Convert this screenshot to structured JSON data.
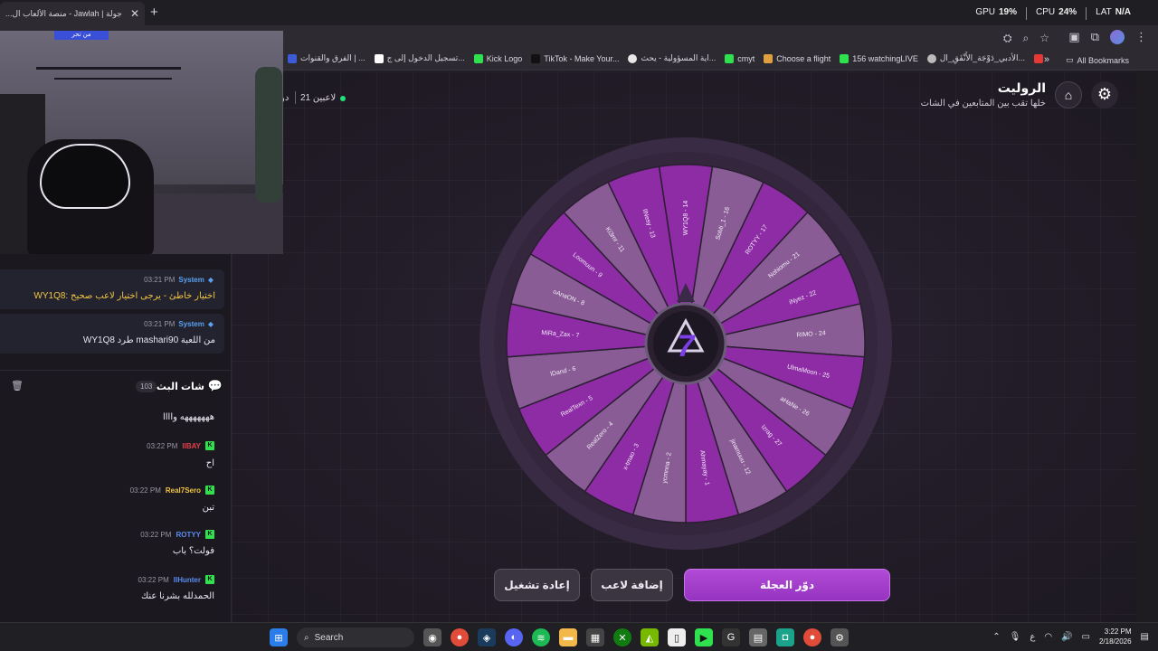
{
  "browser": {
    "tab_title": "جولة | Jawlah - منصة الألعاب ال...",
    "tab_close": "✕",
    "new_tab": "+",
    "hud": {
      "gpu_label": "GPU",
      "gpu_value": "19%",
      "cpu_label": "CPU",
      "cpu_value": "24%",
      "lat_label": "LAT",
      "lat_value": "N/A"
    },
    "bookmarks": [
      "الأدبي_دَوْجَة_الأَنْفَقِ_ال...",
      "156 watchingLIVE",
      "Choose a flight",
      "cmyt",
      "اية المسؤولية - يحث...",
      "TikTok - Make Your...",
      "Kick Logo",
      "تسجيل الدخول إلى ج...",
      "الفرق والقنوات | ..."
    ],
    "bookmarks_more": "»",
    "all_bookmarks": "All Bookmarks"
  },
  "stream_overlay": {
    "camera_tag": "ﻣﻦ ﺗﺤﺮ"
  },
  "app": {
    "title": "الروليت",
    "subtitle": "خلها تقب بين المتابعين في الشات",
    "players": "21 لاعبين",
    "players_fragment": "دو",
    "buttons": {
      "restart": "إعادة تشغيل",
      "add_player": "إضافة لاعب",
      "spin": "دوّر العجلة"
    }
  },
  "wheel": {
    "center_logo": "7",
    "segments": [
      "WY1Q8 - 14",
      "SoMi_1 - 16",
      "ROTYY - 17",
      "Nohiomu - 21",
      "iNyez - 22",
      "RIMO - 24",
      "UlmaMoon - 25",
      "aHaNe - 26",
      "Izrag - 27",
      "jinamuuu - 12",
      "Ahmayay - 1",
      "ycmnna - 2",
      "x-tmao - 3",
      "RealZero - 4",
      "RealTexn - 5",
      "lDand - 6",
      "MiRa_Zax - 7",
      "oAnaON - 8",
      "Loomuun - 9",
      "Ki3mr - 11",
      "llNesy - 13"
    ],
    "colors": {
      "dark": "#8e2ca6",
      "light": "#8a5c96",
      "rim": "#3e2e47"
    }
  },
  "system_messages": [
    {
      "name": "System",
      "time": "03:21 PM",
      "text": "WY1Q8: اختيار خاطئ - يرجى اختيار لاعب صحيح"
    },
    {
      "name": "System",
      "time": "03:21 PM",
      "text": "WY1Q8 طرد mashari90 من اللعبة"
    }
  ],
  "chat": {
    "title": "شات البث",
    "count": "103",
    "messages": [
      {
        "user": "",
        "time": "",
        "text": "هههههههه واااا",
        "color": "#ece8f2"
      },
      {
        "user": "IIBAY",
        "time": "03:22 PM",
        "text": "اح",
        "color": "#e0404a"
      },
      {
        "user": "Real7Sero",
        "time": "03:22 PM",
        "text": "تبن",
        "color": "#f2c542"
      },
      {
        "user": "ROTYY",
        "time": "03:22 PM",
        "text": "فولت؟ باب",
        "color": "#5a8cf0"
      },
      {
        "user": "IlHunter",
        "time": "03:22 PM",
        "text": "الحمدلله بشرنا عنك",
        "color": "#5a8cf0"
      }
    ]
  },
  "taskbar": {
    "search": "Search",
    "time": "3:22 PM",
    "date": "2/18/2026",
    "lang": "ع"
  }
}
